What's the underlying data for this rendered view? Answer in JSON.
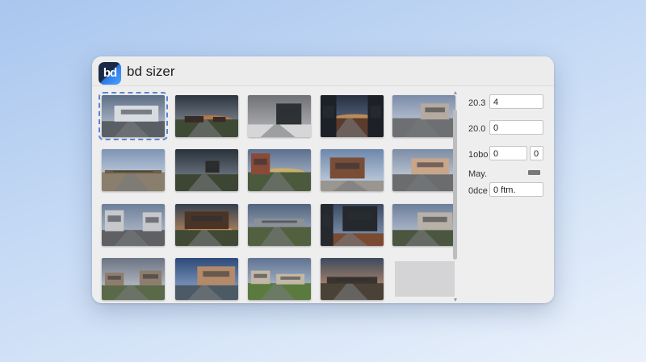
{
  "app": {
    "title": "bd sizer",
    "logo_text": "bd"
  },
  "thumbnails": [
    {
      "id": 1,
      "scene": "row-houses",
      "selected": true
    },
    {
      "id": 2,
      "scene": "field-dusk"
    },
    {
      "id": 3,
      "scene": "interior-gray"
    },
    {
      "id": 4,
      "scene": "corridor-sunset"
    },
    {
      "id": 5,
      "scene": "house-road"
    },
    {
      "id": 6,
      "scene": "road-fence"
    },
    {
      "id": 7,
      "scene": "sign-road"
    },
    {
      "id": 8,
      "scene": "road-barn"
    },
    {
      "id": 9,
      "scene": "window-sky"
    },
    {
      "id": 10,
      "scene": "house-road-2"
    },
    {
      "id": 11,
      "scene": "street-houses"
    },
    {
      "id": 12,
      "scene": "pavilion-sunset"
    },
    {
      "id": 13,
      "scene": "train-road"
    },
    {
      "id": 14,
      "scene": "glass-interior"
    },
    {
      "id": 15,
      "scene": "house-village"
    },
    {
      "id": 16,
      "scene": "house-clouds"
    },
    {
      "id": 17,
      "scene": "house-canal"
    },
    {
      "id": 18,
      "scene": "house-green"
    },
    {
      "id": 19,
      "scene": "town-sunset"
    },
    {
      "id": 20,
      "scene": "empty"
    }
  ],
  "panel": {
    "row1": {
      "label": "20.3",
      "value": "4"
    },
    "row2": {
      "label": "20.0",
      "value": "0"
    },
    "row3": {
      "label": "1obo",
      "value": "0",
      "extra": "0"
    },
    "row4": {
      "label": "May."
    },
    "row5": {
      "label": "0dce",
      "value": "0 ftm."
    }
  },
  "colors": {
    "accent": "#5a84d6",
    "window": "#eeeeef"
  }
}
